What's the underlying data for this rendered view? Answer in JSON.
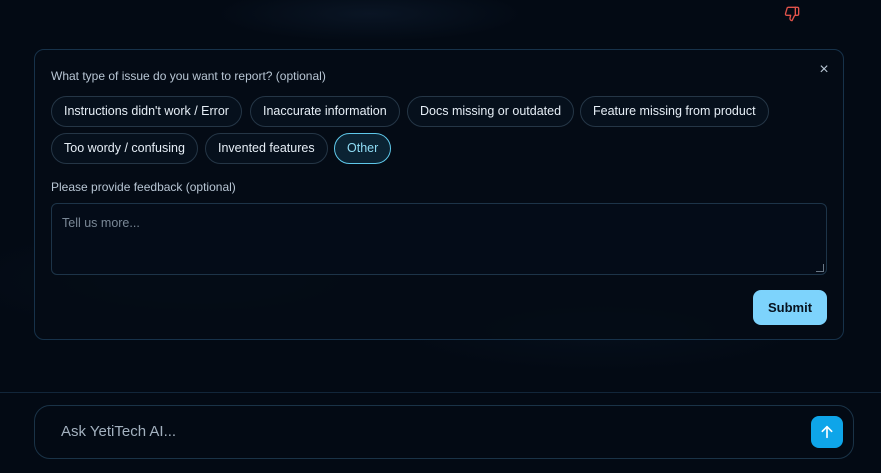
{
  "feedback": {
    "question": "What type of issue do you want to report? (optional)",
    "close_symbol": "×",
    "options": [
      {
        "label": "Instructions didn't work / Error",
        "selected": false
      },
      {
        "label": "Inaccurate information",
        "selected": false
      },
      {
        "label": "Docs missing or outdated",
        "selected": false
      },
      {
        "label": "Feature missing from product",
        "selected": false
      },
      {
        "label": "Too wordy / confusing",
        "selected": false
      },
      {
        "label": "Invented features",
        "selected": false
      },
      {
        "label": "Other",
        "selected": true
      }
    ],
    "feedback_label": "Please provide feedback (optional)",
    "feedback_placeholder": "Tell us more...",
    "feedback_value": "",
    "submit_label": "Submit"
  },
  "chat": {
    "input_placeholder": "Ask YetiTech AI...",
    "input_value": ""
  },
  "icons": {
    "reaction": "thumbs-down-icon",
    "close": "close-icon",
    "send": "arrow-up-icon"
  },
  "colors": {
    "accent": "#7dd3fc",
    "send_button": "#0ea5e9",
    "selected_chip_border": "#5fc8ea",
    "thumbs_down": "#e0524a"
  }
}
